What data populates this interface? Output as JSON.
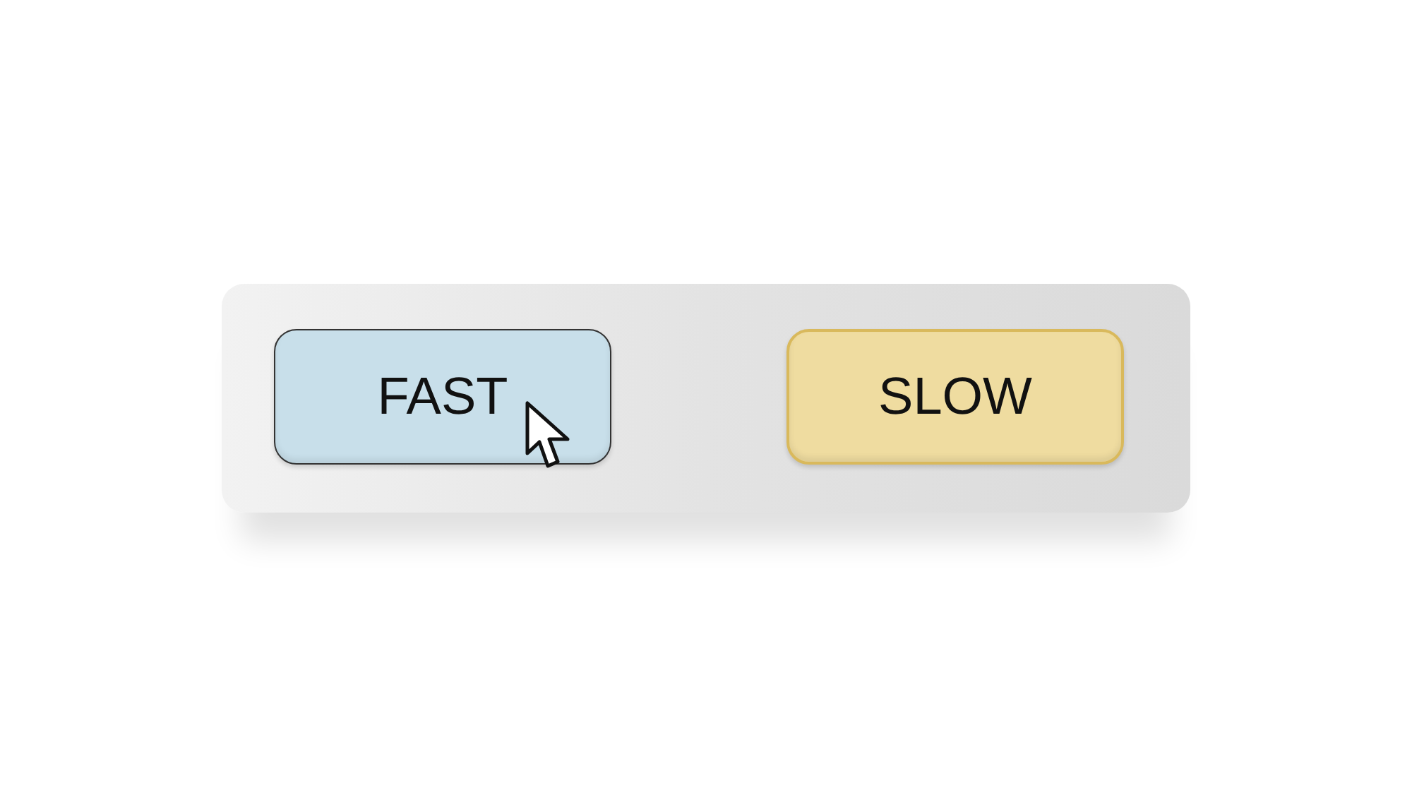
{
  "buttons": [
    {
      "label": "FAST",
      "color": "#c8dfea",
      "hovered": true
    },
    {
      "label": "SLOW",
      "color": "#efdca0",
      "hovered": false
    }
  ]
}
